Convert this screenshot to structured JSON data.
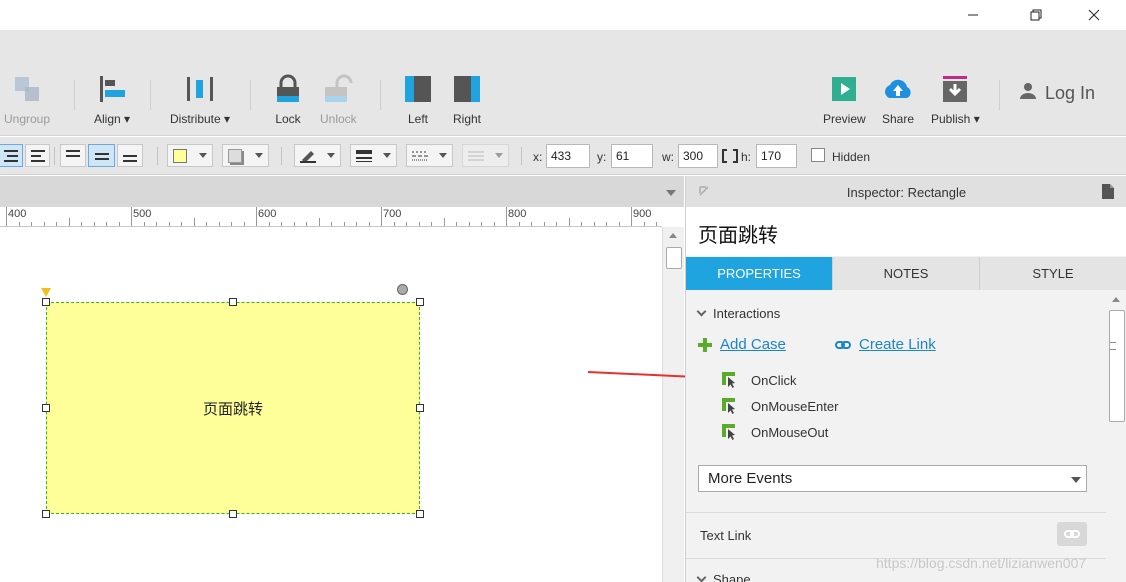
{
  "toolbar": {
    "ungroup": "Ungroup",
    "align": "Align",
    "distribute": "Distribute",
    "lock": "Lock",
    "unlock": "Unlock",
    "left": "Left",
    "right": "Right",
    "preview": "Preview",
    "share": "Share",
    "publish": "Publish",
    "login": "Log In",
    "dropdown_marker": "▾"
  },
  "formatbar": {
    "x_label": "x:",
    "x_value": "433",
    "y_label": "y:",
    "y_value": "61",
    "w_label": "w:",
    "w_value": "300",
    "h_label": "h:",
    "h_value": "170",
    "hidden_label": "Hidden",
    "fill_color": "#ffff99"
  },
  "ruler": {
    "labels": [
      "400",
      "500",
      "600",
      "700",
      "800",
      "900"
    ]
  },
  "canvas": {
    "shape_text": "页面跳转",
    "shape_fill": "#ffff99",
    "shape_border": "#2fb82f"
  },
  "inspector": {
    "title": "Inspector: Rectangle",
    "widget_name": "页面跳转",
    "tabs": [
      "PROPERTIES",
      "NOTES",
      "STYLE"
    ],
    "section_interactions": "Interactions",
    "add_case": "Add Case",
    "create_link": "Create Link",
    "events": [
      "OnClick",
      "OnMouseEnter",
      "OnMouseOut"
    ],
    "more_events": "More Events",
    "text_link": "Text Link",
    "section_shape": "Shape",
    "accent_color": "#1fa4e0"
  },
  "watermark": "https://blog.csdn.net/lizianwen007"
}
